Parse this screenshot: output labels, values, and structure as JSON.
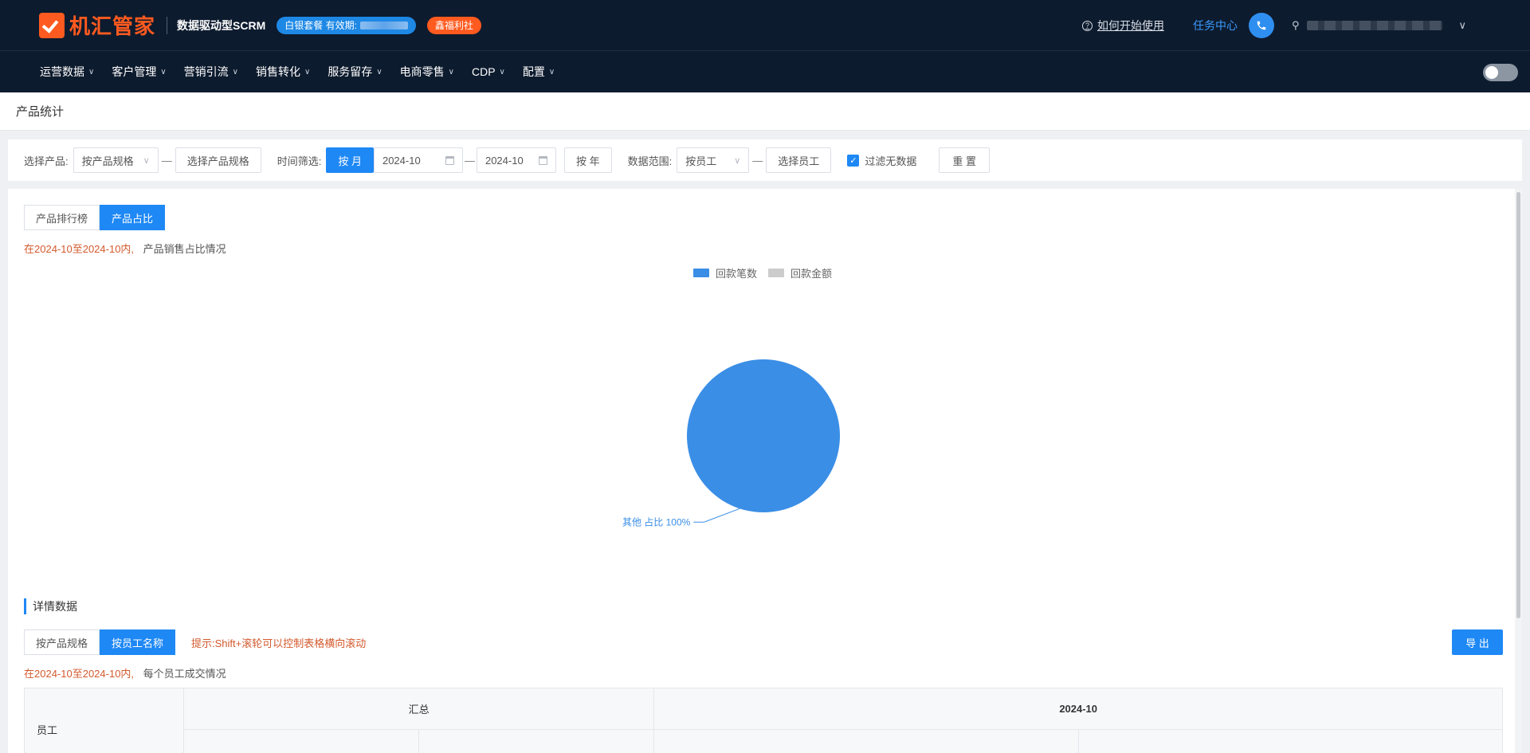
{
  "header": {
    "logo_text": "机汇管家",
    "subtitle": "数据驱动型SCRM",
    "package_badge": "白银套餐 有效期:",
    "benefit_badge": "鑫福利社",
    "help_link": "如何开始使用",
    "task_center": "任务中心",
    "icons": [
      "logo-check-icon",
      "help-circle-icon",
      "phone-icon",
      "user-icon",
      "chevron-down-icon"
    ]
  },
  "nav": {
    "items": [
      "运营数据",
      "客户管理",
      "营销引流",
      "销售转化",
      "服务留存",
      "电商零售",
      "CDP",
      "配置"
    ]
  },
  "page": {
    "title": "产品统计"
  },
  "filters": {
    "product_label": "选择产品:",
    "product_mode": "按产品规格",
    "product_picker": "选择产品规格",
    "time_label": "时间筛选:",
    "by_month": "按 月",
    "start_month": "2024-10",
    "end_month": "2024-10",
    "by_year": "按 年",
    "scope_label": "数据范围:",
    "scope_mode": "按员工",
    "employee_picker": "选择员工",
    "filter_empty_label": "过滤无数据",
    "filter_empty_checked": true,
    "reset": "重 置"
  },
  "chart_tabs": {
    "ranking": "产品排行榜",
    "share": "产品占比"
  },
  "chart_info": {
    "range": "在2024-10至2024-10内,",
    "desc": "产品销售占比情况"
  },
  "chart_data": {
    "type": "pie",
    "legend": [
      "回款笔数",
      "回款金额"
    ],
    "legend_colors": [
      "#3a8ee6",
      "#cccccc"
    ],
    "slices": [
      {
        "name": "其他",
        "percent": 100,
        "color": "#3a8ee6"
      }
    ],
    "label": "其他 占比 100%"
  },
  "details": {
    "title": "详情数据",
    "tab_by_product": "按产品规格",
    "tab_by_employee": "按员工名称",
    "tip": "提示:Shift+滚轮可以控制表格横向滚动",
    "export": "导 出",
    "range": "在2024-10至2024-10内,",
    "desc": "每个员工成交情况",
    "table": {
      "employee_header": "员工",
      "groups": [
        "汇总",
        "2024-10"
      ]
    }
  }
}
